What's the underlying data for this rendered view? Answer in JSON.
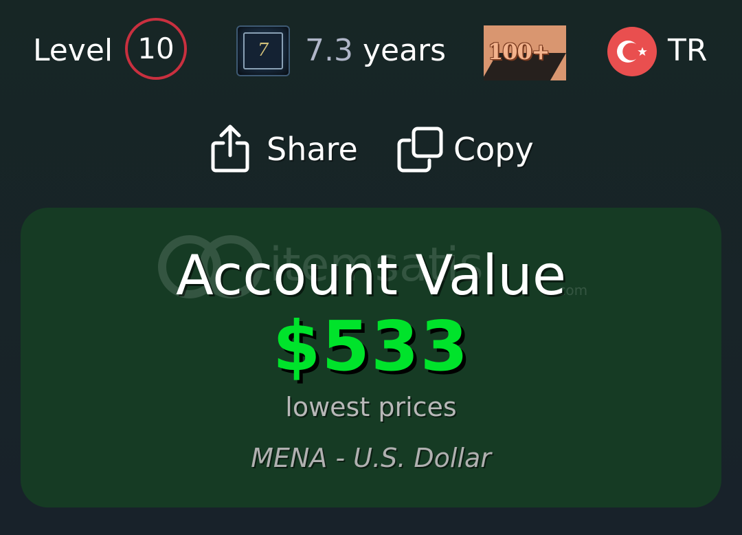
{
  "profile": {
    "level_label": "Level",
    "level_value": "10",
    "years_badge_digit": "7",
    "years_value": "7.3",
    "years_unit": "years",
    "games_badge_text": "100+",
    "country_code": "TR"
  },
  "actions": {
    "share_label": "Share",
    "copy_label": "Copy"
  },
  "account_value": {
    "watermark_brand": "itemsatis",
    "watermark_domain": ".com",
    "title": "Account Value",
    "amount": "$533",
    "subtitle": "lowest prices",
    "region_currency": "MENA - U.S. Dollar"
  },
  "colors": {
    "level_ring": "#c9303f",
    "amount_green": "#00e32b",
    "card_bg": "#163b24",
    "flag_red": "#e94f4f"
  },
  "icons": {
    "share": "share-icon",
    "copy": "copy-icon",
    "flag": "turkey-flag-icon"
  }
}
